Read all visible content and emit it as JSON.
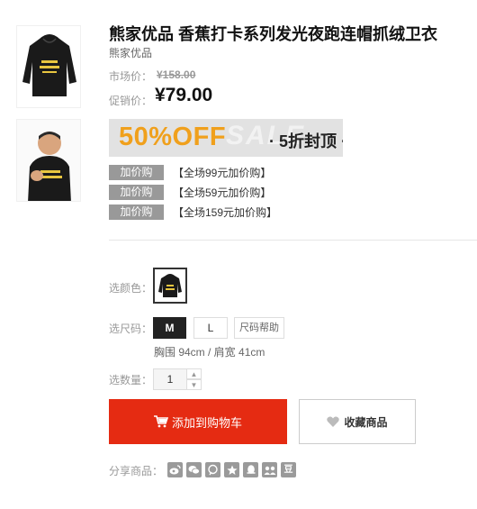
{
  "product": {
    "title": "熊家优品 香蕉打卡系列发光夜跑连帽抓绒卫衣",
    "brand": "熊家优品",
    "market_price_label": "市场价：",
    "market_price": "¥158.00",
    "sale_price_label": "促销价：",
    "sale_price": "¥79.00"
  },
  "promo_banner": {
    "headline": "50%OFF",
    "dot": "·",
    "subtext": "5折封顶",
    "background_color": "#e2e2e2",
    "accent_color": "#f0a01c"
  },
  "addon_offers": [
    {
      "tag": "加价购",
      "text": "【全场99元加价购】"
    },
    {
      "tag": "加价购",
      "text": "【全场59元加价购】"
    },
    {
      "tag": "加价购",
      "text": "【全场159元加价购】"
    }
  ],
  "options": {
    "color_label": "选颜色：",
    "size_label": "选尺码：",
    "sizes": [
      "M",
      "L"
    ],
    "selected_size": "M",
    "size_help": "尺码帮助",
    "size_info": "胸围 94cm / 肩宽 41cm",
    "quantity_label": "选数量：",
    "quantity": "1"
  },
  "actions": {
    "add_to_cart": "添加到购物车",
    "favorite": "收藏商品",
    "cart_color": "#e52b12"
  },
  "share": {
    "label": "分享商品：",
    "icons": [
      "weibo-icon",
      "wechat-icon",
      "qq-zone-icon",
      "star-icon",
      "qq-icon",
      "friends-icon",
      "douban-icon"
    ],
    "douban_char": "豆"
  }
}
